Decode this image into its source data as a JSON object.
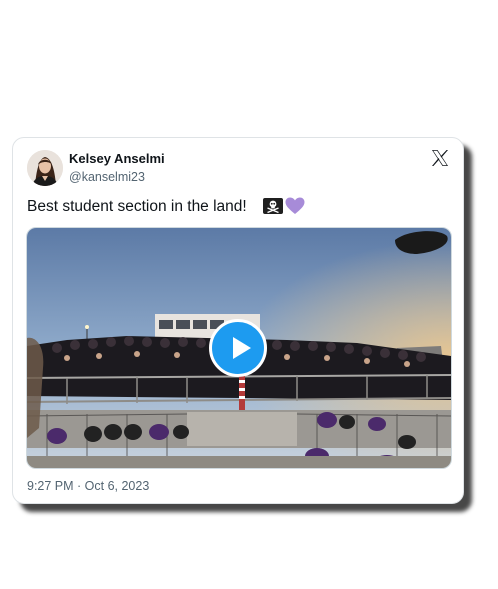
{
  "tweet": {
    "author": {
      "display_name": "Kelsey Anselmi",
      "handle": "@kanselmi23",
      "avatar_icon": "profile-photo"
    },
    "text": "Best student section in the land!",
    "emojis": [
      "pirate-flag-emoji",
      "purple-heart-emoji"
    ],
    "media": {
      "type": "video",
      "thumbnail": "stadium-student-section-photo",
      "play_icon": "play-icon"
    },
    "timestamp": "9:27 PM · Oct 6, 2023"
  },
  "platform_icon": "x-logo-icon",
  "colors": {
    "accent": "#1d9bf0",
    "text_primary": "#0f1419",
    "text_secondary": "#536471",
    "heart": "#a78bd8"
  }
}
